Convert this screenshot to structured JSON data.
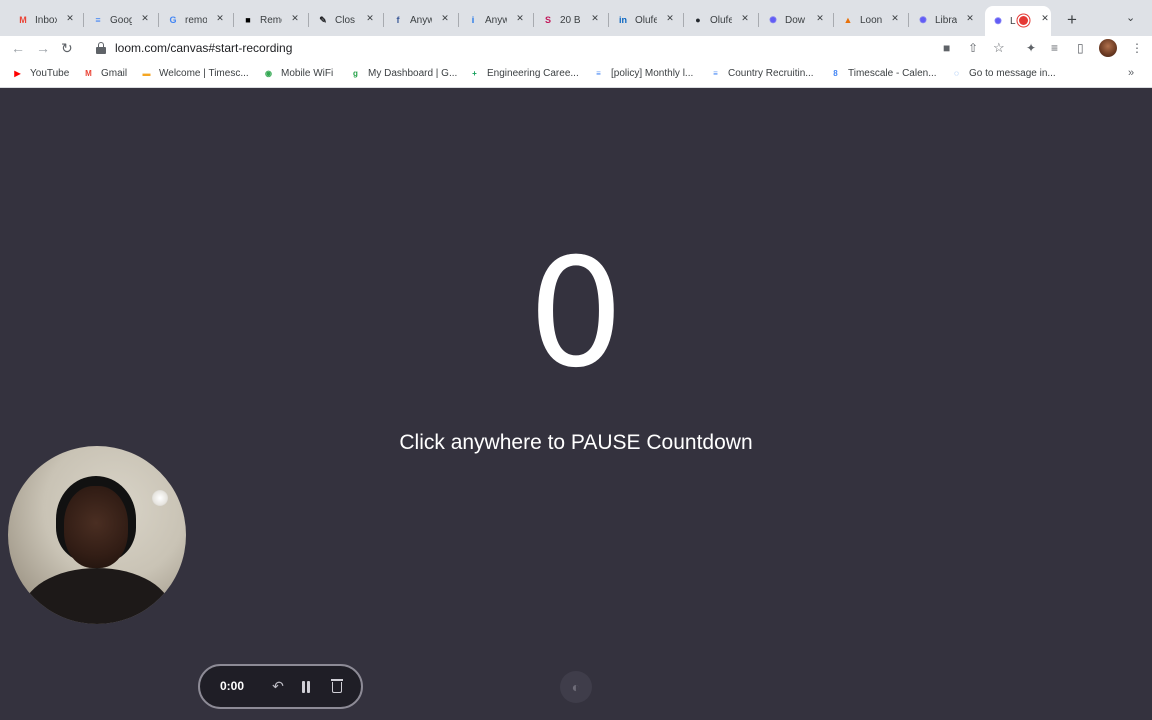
{
  "browser": {
    "tabs": [
      {
        "label": "Inbox",
        "icon": "gmail-icon",
        "color": "#ea4335",
        "glyph": "M"
      },
      {
        "label": "Goog",
        "icon": "google-docs-icon",
        "color": "#4285f4",
        "glyph": "≡"
      },
      {
        "label": "remo",
        "icon": "google-icon",
        "color": "#4285f4",
        "glyph": "G"
      },
      {
        "label": "Remo",
        "icon": "remote-icon",
        "color": "#000000",
        "glyph": "■"
      },
      {
        "label": "Clos",
        "icon": "pencil-icon",
        "color": "#202124",
        "glyph": "✎"
      },
      {
        "label": "Anyw",
        "icon": "facebook-icon",
        "color": "#3b5998",
        "glyph": "f"
      },
      {
        "label": "Anyw",
        "icon": "info-icon",
        "color": "#1a73e8",
        "glyph": "i"
      },
      {
        "label": "20 B",
        "icon": "s-icon",
        "color": "#c2185b",
        "glyph": "S"
      },
      {
        "label": "Olufe",
        "icon": "linkedin-icon",
        "color": "#0a66c2",
        "glyph": "in"
      },
      {
        "label": "Olufe",
        "icon": "github-icon",
        "color": "#24292e",
        "glyph": "●"
      },
      {
        "label": "Dow",
        "icon": "loom-icon",
        "color": "#625df5",
        "glyph": "✺"
      },
      {
        "label": "Loon",
        "icon": "loom-landing-icon",
        "color": "#e8710a",
        "glyph": "▲"
      },
      {
        "label": "Libra",
        "icon": "loom-icon",
        "color": "#625df5",
        "glyph": "✺"
      },
      {
        "label": "L",
        "icon": "loom-icon",
        "color": "#625df5",
        "glyph": "✺"
      }
    ],
    "url": "loom.com/canvas#start-recording",
    "bookmarks": [
      {
        "label": "YouTube",
        "icon": "youtube-icon",
        "color": "#ff0000",
        "glyph": "▶"
      },
      {
        "label": "Gmail",
        "icon": "gmail-icon",
        "color": "#ea4335",
        "glyph": "M"
      },
      {
        "label": "Welcome | Timesc...",
        "icon": "timescale-icon",
        "color": "#f5a623",
        "glyph": "▬"
      },
      {
        "label": "Mobile WiFi",
        "icon": "wifi-icon",
        "color": "#34a853",
        "glyph": "◉"
      },
      {
        "label": "My Dashboard | G...",
        "icon": "greenhouse-icon",
        "color": "#24a148",
        "glyph": "g"
      },
      {
        "label": "Engineering Caree...",
        "icon": "google-sheets-icon",
        "color": "#0f9d58",
        "glyph": "+"
      },
      {
        "label": "[policy] Monthly l...",
        "icon": "google-docs-icon",
        "color": "#4285f4",
        "glyph": "≡"
      },
      {
        "label": "Country Recruitin...",
        "icon": "google-docs-icon",
        "color": "#4285f4",
        "glyph": "≡"
      },
      {
        "label": "Timescale - Calen...",
        "icon": "calendar-icon",
        "color": "#4285f4",
        "glyph": "8"
      },
      {
        "label": "Go to message in...",
        "icon": "chat-icon",
        "color": "#1a73e8",
        "glyph": "◌"
      }
    ]
  },
  "countdown": {
    "value": "0",
    "message": "Click anywhere to PAUSE Countdown"
  },
  "recorder": {
    "timer": "0:00"
  }
}
